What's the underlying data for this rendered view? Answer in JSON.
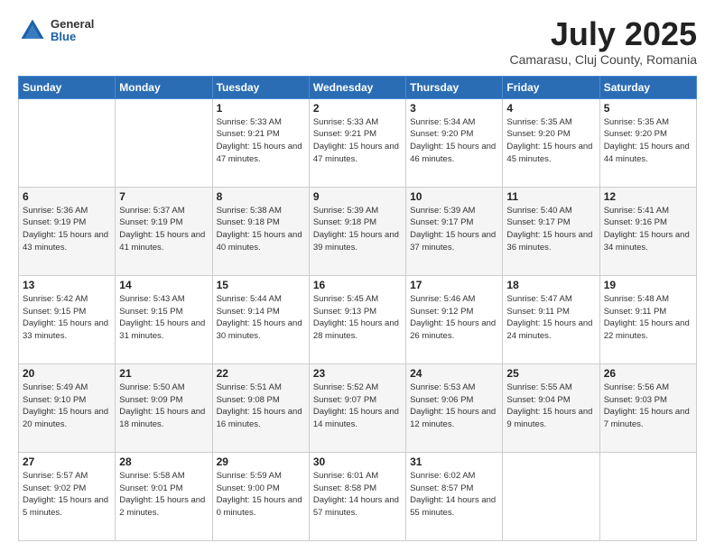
{
  "header": {
    "logo_general": "General",
    "logo_blue": "Blue",
    "title": "July 2025",
    "subtitle": "Camarasu, Cluj County, Romania"
  },
  "days_of_week": [
    "Sunday",
    "Monday",
    "Tuesday",
    "Wednesday",
    "Thursday",
    "Friday",
    "Saturday"
  ],
  "weeks": [
    [
      {
        "day": "",
        "info": ""
      },
      {
        "day": "",
        "info": ""
      },
      {
        "day": "1",
        "info": "Sunrise: 5:33 AM\nSunset: 9:21 PM\nDaylight: 15 hours\nand 47 minutes."
      },
      {
        "day": "2",
        "info": "Sunrise: 5:33 AM\nSunset: 9:21 PM\nDaylight: 15 hours\nand 47 minutes."
      },
      {
        "day": "3",
        "info": "Sunrise: 5:34 AM\nSunset: 9:20 PM\nDaylight: 15 hours\nand 46 minutes."
      },
      {
        "day": "4",
        "info": "Sunrise: 5:35 AM\nSunset: 9:20 PM\nDaylight: 15 hours\nand 45 minutes."
      },
      {
        "day": "5",
        "info": "Sunrise: 5:35 AM\nSunset: 9:20 PM\nDaylight: 15 hours\nand 44 minutes."
      }
    ],
    [
      {
        "day": "6",
        "info": "Sunrise: 5:36 AM\nSunset: 9:19 PM\nDaylight: 15 hours\nand 43 minutes."
      },
      {
        "day": "7",
        "info": "Sunrise: 5:37 AM\nSunset: 9:19 PM\nDaylight: 15 hours\nand 41 minutes."
      },
      {
        "day": "8",
        "info": "Sunrise: 5:38 AM\nSunset: 9:18 PM\nDaylight: 15 hours\nand 40 minutes."
      },
      {
        "day": "9",
        "info": "Sunrise: 5:39 AM\nSunset: 9:18 PM\nDaylight: 15 hours\nand 39 minutes."
      },
      {
        "day": "10",
        "info": "Sunrise: 5:39 AM\nSunset: 9:17 PM\nDaylight: 15 hours\nand 37 minutes."
      },
      {
        "day": "11",
        "info": "Sunrise: 5:40 AM\nSunset: 9:17 PM\nDaylight: 15 hours\nand 36 minutes."
      },
      {
        "day": "12",
        "info": "Sunrise: 5:41 AM\nSunset: 9:16 PM\nDaylight: 15 hours\nand 34 minutes."
      }
    ],
    [
      {
        "day": "13",
        "info": "Sunrise: 5:42 AM\nSunset: 9:15 PM\nDaylight: 15 hours\nand 33 minutes."
      },
      {
        "day": "14",
        "info": "Sunrise: 5:43 AM\nSunset: 9:15 PM\nDaylight: 15 hours\nand 31 minutes."
      },
      {
        "day": "15",
        "info": "Sunrise: 5:44 AM\nSunset: 9:14 PM\nDaylight: 15 hours\nand 30 minutes."
      },
      {
        "day": "16",
        "info": "Sunrise: 5:45 AM\nSunset: 9:13 PM\nDaylight: 15 hours\nand 28 minutes."
      },
      {
        "day": "17",
        "info": "Sunrise: 5:46 AM\nSunset: 9:12 PM\nDaylight: 15 hours\nand 26 minutes."
      },
      {
        "day": "18",
        "info": "Sunrise: 5:47 AM\nSunset: 9:11 PM\nDaylight: 15 hours\nand 24 minutes."
      },
      {
        "day": "19",
        "info": "Sunrise: 5:48 AM\nSunset: 9:11 PM\nDaylight: 15 hours\nand 22 minutes."
      }
    ],
    [
      {
        "day": "20",
        "info": "Sunrise: 5:49 AM\nSunset: 9:10 PM\nDaylight: 15 hours\nand 20 minutes."
      },
      {
        "day": "21",
        "info": "Sunrise: 5:50 AM\nSunset: 9:09 PM\nDaylight: 15 hours\nand 18 minutes."
      },
      {
        "day": "22",
        "info": "Sunrise: 5:51 AM\nSunset: 9:08 PM\nDaylight: 15 hours\nand 16 minutes."
      },
      {
        "day": "23",
        "info": "Sunrise: 5:52 AM\nSunset: 9:07 PM\nDaylight: 15 hours\nand 14 minutes."
      },
      {
        "day": "24",
        "info": "Sunrise: 5:53 AM\nSunset: 9:06 PM\nDaylight: 15 hours\nand 12 minutes."
      },
      {
        "day": "25",
        "info": "Sunrise: 5:55 AM\nSunset: 9:04 PM\nDaylight: 15 hours\nand 9 minutes."
      },
      {
        "day": "26",
        "info": "Sunrise: 5:56 AM\nSunset: 9:03 PM\nDaylight: 15 hours\nand 7 minutes."
      }
    ],
    [
      {
        "day": "27",
        "info": "Sunrise: 5:57 AM\nSunset: 9:02 PM\nDaylight: 15 hours\nand 5 minutes."
      },
      {
        "day": "28",
        "info": "Sunrise: 5:58 AM\nSunset: 9:01 PM\nDaylight: 15 hours\nand 2 minutes."
      },
      {
        "day": "29",
        "info": "Sunrise: 5:59 AM\nSunset: 9:00 PM\nDaylight: 15 hours\nand 0 minutes."
      },
      {
        "day": "30",
        "info": "Sunrise: 6:01 AM\nSunset: 8:58 PM\nDaylight: 14 hours\nand 57 minutes."
      },
      {
        "day": "31",
        "info": "Sunrise: 6:02 AM\nSunset: 8:57 PM\nDaylight: 14 hours\nand 55 minutes."
      },
      {
        "day": "",
        "info": ""
      },
      {
        "day": "",
        "info": ""
      }
    ]
  ]
}
